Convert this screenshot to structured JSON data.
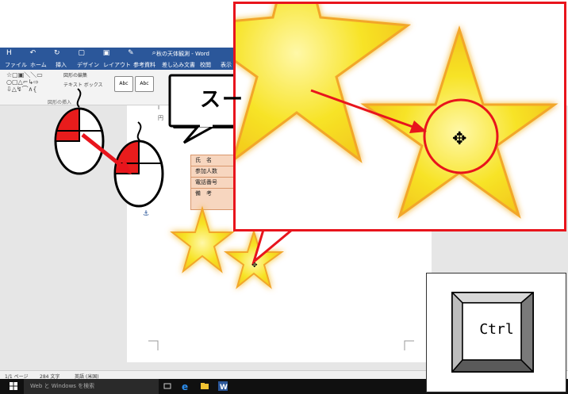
{
  "word": {
    "title": "秋の天体観測 - Word",
    "quick_access": "H ↶ ↻ ▢ ▣ ✎ ⌕",
    "menu": [
      "ファイル",
      "ホーム",
      "挿入",
      "デザイン",
      "レイアウト",
      "参考資料",
      "差し込み文書",
      "校閲",
      "表示"
    ],
    "ribbon": {
      "edit_shape": "図形の編集",
      "text_box": "テキスト ボックス",
      "style1": "Abc",
      "style2": "Abc",
      "group_insert": "図形の挿入"
    },
    "doc_frag_1": "I",
    "doc_frag_2": "円"
  },
  "form_table": {
    "rows": [
      "氏　名",
      "参加人数",
      "電話番号",
      "備　考"
    ]
  },
  "status_bar": {
    "page": "1/1 ページ",
    "words": "284 文字",
    "lang": "英語 (米国)"
  },
  "taskbar": {
    "search_placeholder": "Web と Windows を検索"
  },
  "callout": {
    "text": "スー"
  },
  "ctrl_key": {
    "label": "Ctrl"
  },
  "colors": {
    "word_blue": "#2b579a",
    "highlight_red": "#e8141c",
    "star_yellow": "#f7e326",
    "star_border": "#f2a62a"
  }
}
